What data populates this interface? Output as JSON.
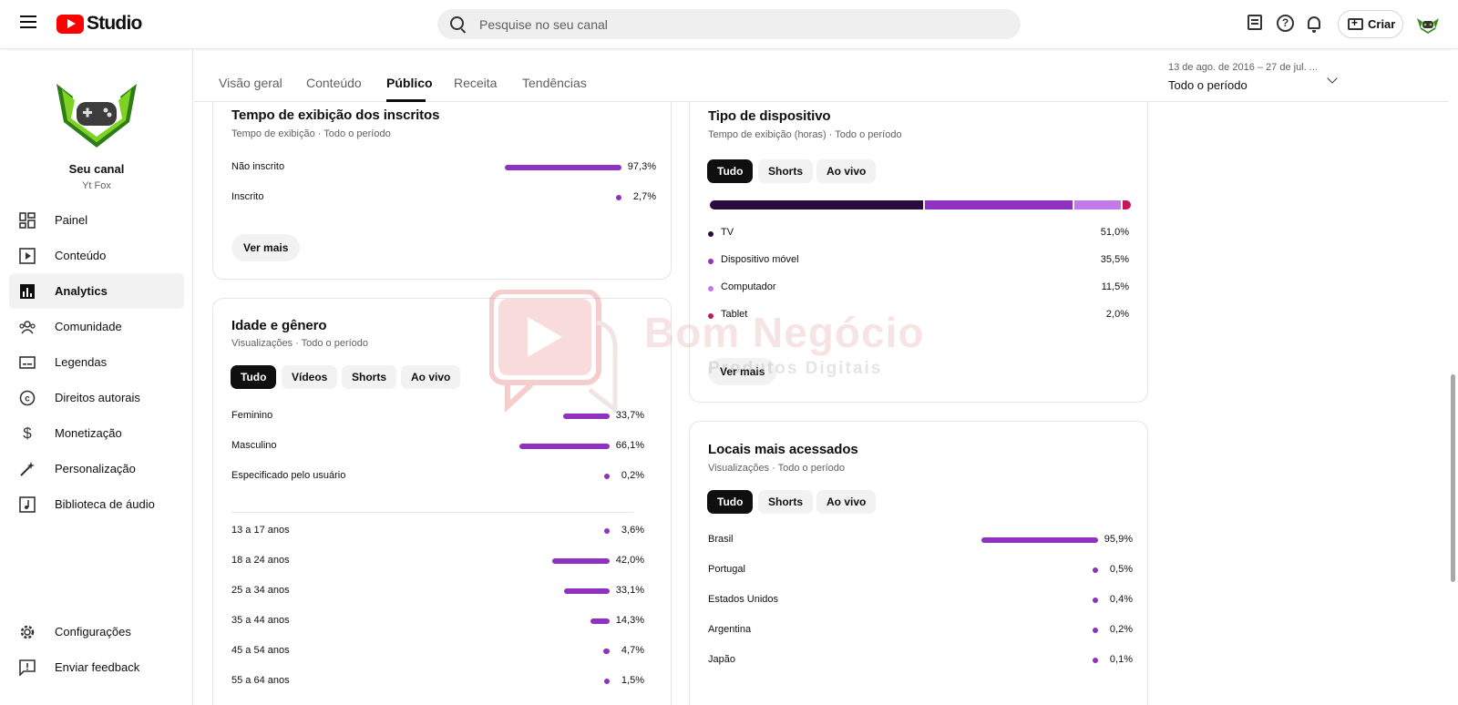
{
  "app": {
    "logo_text": "Studio"
  },
  "search": {
    "placeholder": "Pesquise no seu canal"
  },
  "topbar": {
    "create_label": "Criar"
  },
  "channel": {
    "name": "Seu canal",
    "handle": "Yt Fox"
  },
  "sidebar": {
    "items": [
      {
        "label": "Painel",
        "icon": "dashboard-icon"
      },
      {
        "label": "Conteúdo",
        "icon": "content-icon"
      },
      {
        "label": "Analytics",
        "icon": "analytics-icon",
        "active": true
      },
      {
        "label": "Comunidade",
        "icon": "community-icon"
      },
      {
        "label": "Legendas",
        "icon": "subtitles-icon"
      },
      {
        "label": "Direitos autorais",
        "icon": "copyright-icon"
      },
      {
        "label": "Monetização",
        "icon": "dollar-icon"
      },
      {
        "label": "Personalização",
        "icon": "magic-wand-icon"
      },
      {
        "label": "Biblioteca de áudio",
        "icon": "audio-library-icon"
      }
    ],
    "bottom": [
      {
        "label": "Configurações",
        "icon": "gear-icon"
      },
      {
        "label": "Enviar feedback",
        "icon": "feedback-icon"
      }
    ]
  },
  "tabs": [
    {
      "label": "Visão geral"
    },
    {
      "label": "Conteúdo"
    },
    {
      "label": "Público",
      "active": true
    },
    {
      "label": "Receita"
    },
    {
      "label": "Tendências"
    }
  ],
  "date_range": {
    "range": "13 de ago. de 2016 – 27 de jul. ...",
    "label": "Todo o período"
  },
  "subscribers_card": {
    "title": "Tempo de exibição dos inscritos",
    "subtitle": "Tempo de exibição · Todo o período",
    "rows": [
      {
        "label": "Não inscrito",
        "value": "97,3%",
        "pct": 97.3
      },
      {
        "label": "Inscrito",
        "value": "2,7%",
        "pct": 2.7
      }
    ],
    "more_label": "Ver mais"
  },
  "device_card": {
    "title": "Tipo de dispositivo",
    "subtitle": "Tempo de exibição (horas) · Todo o período",
    "chips": [
      "Tudo",
      "Shorts",
      "Ao vivo"
    ],
    "rows": [
      {
        "label": "TV",
        "value": "51,0%",
        "pct": 51.0,
        "color": "#2b0a3d"
      },
      {
        "label": "Dispositivo móvel",
        "value": "35,5%",
        "pct": 35.5,
        "color": "#8e32bf"
      },
      {
        "label": "Computador",
        "value": "11,5%",
        "pct": 11.5,
        "color": "#c17be8"
      },
      {
        "label": "Tablet",
        "value": "2,0%",
        "pct": 2.0,
        "color": "#c2185b"
      }
    ],
    "more_label": "Ver mais"
  },
  "age_gender_card": {
    "title": "Idade e gênero",
    "subtitle": "Visualizações · Todo o período",
    "chips": [
      "Tudo",
      "Vídeos",
      "Shorts",
      "Ao vivo"
    ],
    "gender_rows": [
      {
        "label": "Feminino",
        "value": "33,7%",
        "pct": 33.7
      },
      {
        "label": "Masculino",
        "value": "66,1%",
        "pct": 66.1
      },
      {
        "label": "Especificado pelo usuário",
        "value": "0,2%",
        "pct": 0.2
      }
    ],
    "age_rows": [
      {
        "label": "13 a 17 anos",
        "value": "3,6%",
        "pct": 3.6
      },
      {
        "label": "18 a 24 anos",
        "value": "42,0%",
        "pct": 42.0
      },
      {
        "label": "25 a 34 anos",
        "value": "33,1%",
        "pct": 33.1
      },
      {
        "label": "35 a 44 anos",
        "value": "14,3%",
        "pct": 14.3
      },
      {
        "label": "45 a 54 anos",
        "value": "4,7%",
        "pct": 4.7
      },
      {
        "label": "55 a 64 anos",
        "value": "1,5%",
        "pct": 1.5
      }
    ]
  },
  "locations_card": {
    "title": "Locais mais acessados",
    "subtitle": "Visualizações · Todo o período",
    "chips": [
      "Tudo",
      "Shorts",
      "Ao vivo"
    ],
    "rows": [
      {
        "label": "Brasil",
        "value": "95,9%",
        "pct": 95.9
      },
      {
        "label": "Portugal",
        "value": "0,5%",
        "pct": 0.5
      },
      {
        "label": "Estados Unidos",
        "value": "0,4%",
        "pct": 0.4
      },
      {
        "label": "Argentina",
        "value": "0,2%",
        "pct": 0.2
      },
      {
        "label": "Japão",
        "value": "0,1%",
        "pct": 0.1
      }
    ]
  },
  "watermark": {
    "line1": "Bom Negócio",
    "line2": "Produtos Digitais"
  },
  "colors": {
    "bar": "#8e32bf",
    "accent_red": "#ff0000"
  }
}
